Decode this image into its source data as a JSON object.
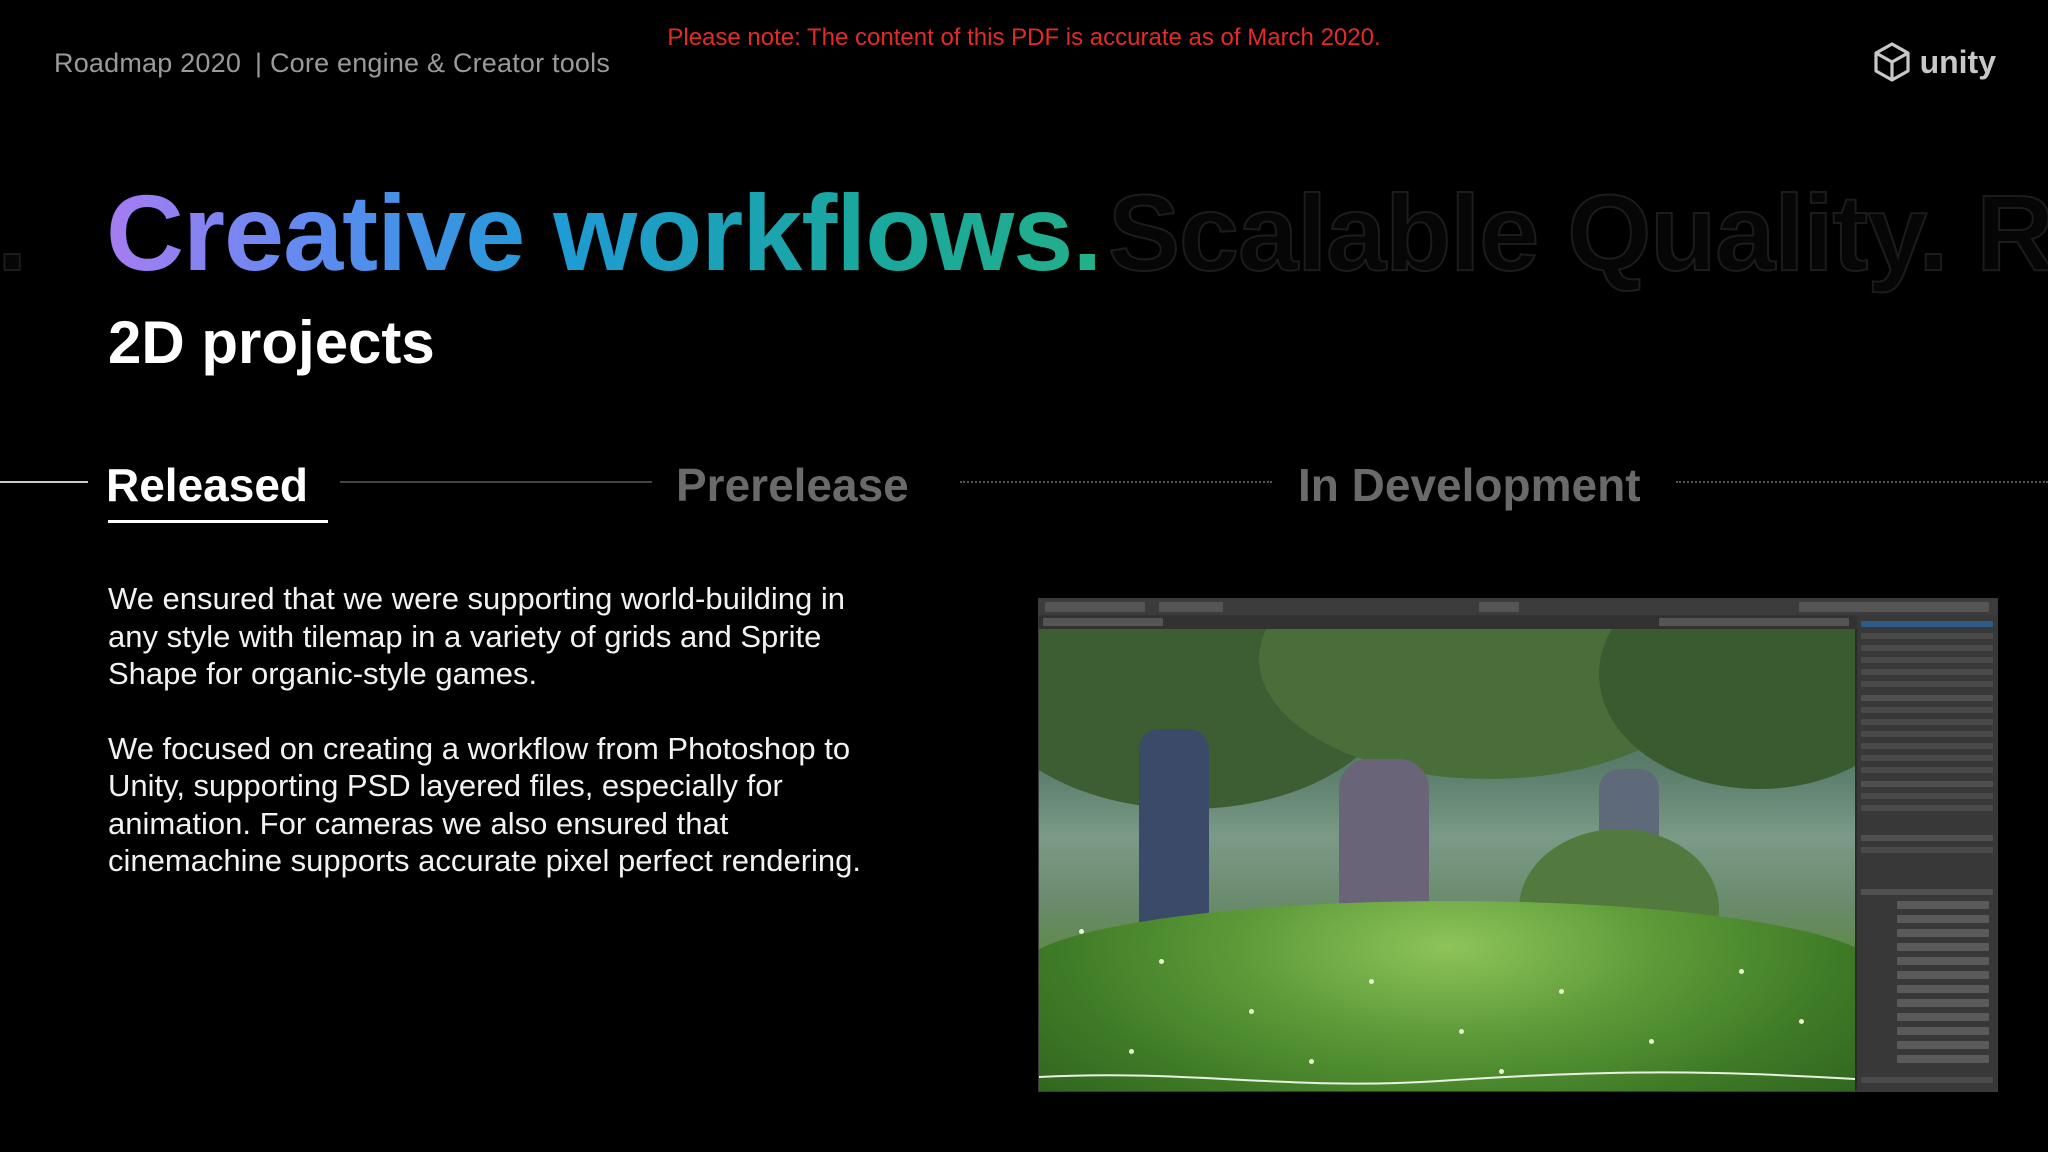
{
  "header": {
    "roadmap_label": "Roadmap 2020",
    "section_label": "| Core engine & Creator tools",
    "notice": "Please note: The content of this PDF is accurate as of March 2020.",
    "logo_text": "unity"
  },
  "hero": {
    "ghost_left": "e.",
    "title": "Creative workflows.",
    "ghost_right": "Scalable Quality.  Re",
    "subtitle": "2D projects"
  },
  "tabs": {
    "released": "Released",
    "prerelease": "Prerelease",
    "in_development": "In Development",
    "active": "Released"
  },
  "body": {
    "paragraph1": "We ensured that we were supporting world-building in any style with tilemap in a variety of grids and Sprite Shape for organic-style games.",
    "paragraph2": "We focused on creating a workflow from Photoshop to Unity, supporting PSD layered files, especially for animation. For cameras we also ensured that cinemachine supports accurate pixel perfect rendering."
  },
  "colors": {
    "background": "#000000",
    "notice_red": "#e42a2a",
    "gradient_start": "#a77cf2",
    "gradient_end": "#22b08a"
  },
  "icons": {
    "logo": "unity-cube-icon"
  }
}
